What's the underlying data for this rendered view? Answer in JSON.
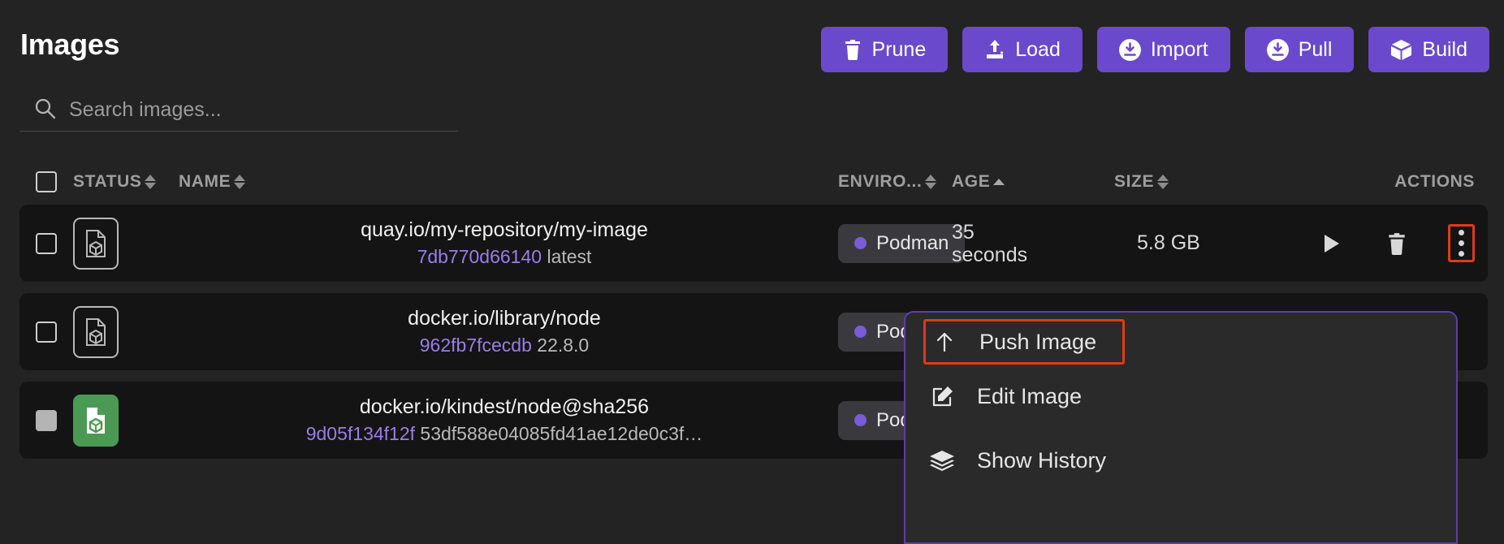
{
  "header": {
    "title": "Images",
    "buttons": [
      {
        "label": "Prune",
        "icon": "trash-icon"
      },
      {
        "label": "Load",
        "icon": "upload-icon"
      },
      {
        "label": "Import",
        "icon": "download-circle-icon"
      },
      {
        "label": "Pull",
        "icon": "download-circle-icon"
      },
      {
        "label": "Build",
        "icon": "cube-icon"
      }
    ],
    "accent_color": "#6a49cc"
  },
  "search": {
    "placeholder": "Search images...",
    "value": "",
    "icon": "search-icon"
  },
  "table": {
    "columns": [
      {
        "key": "check",
        "label": "",
        "sortable": false
      },
      {
        "key": "status",
        "label": "STATUS",
        "sortable": true,
        "sort": "none"
      },
      {
        "key": "name",
        "label": "NAME",
        "sortable": true,
        "sort": "none"
      },
      {
        "key": "env",
        "label": "ENVIRO...",
        "sortable": true,
        "sort": "none"
      },
      {
        "key": "age",
        "label": "AGE",
        "sortable": true,
        "sort": "asc"
      },
      {
        "key": "size",
        "label": "SIZE",
        "sortable": true,
        "sort": "none"
      },
      {
        "key": "actions",
        "label": "ACTIONS",
        "sortable": false
      }
    ],
    "rows": [
      {
        "checked": false,
        "status_icon": "image-file-icon",
        "status_color": "#b9b9b9",
        "name": "quay.io/my-repository/my-image",
        "image_id": "7db770d66140",
        "tag": "latest",
        "environment": "Podman",
        "age": "35 seconds",
        "size": "5.8 GB",
        "actions": [
          "run-icon",
          "delete-icon",
          "kebab-icon"
        ],
        "kebab_highlighted": true
      },
      {
        "checked": false,
        "status_icon": "image-file-icon",
        "status_color": "#b9b9b9",
        "name": "docker.io/library/node",
        "image_id": "962fb7fcecdb",
        "tag": "22.8.0",
        "environment": "Podman",
        "age": "",
        "size": "",
        "actions": [],
        "kebab_highlighted": false
      },
      {
        "checked": true,
        "status_icon": "image-file-icon",
        "status_color": "#4b9a54",
        "name": "docker.io/kindest/node@sha256",
        "image_id": "9d05f134f12f",
        "tag": "53df588e04085fd41ae12de0c3f…",
        "environment": "Podman",
        "age": "",
        "size": "",
        "actions": [],
        "kebab_highlighted": false
      }
    ]
  },
  "dropdown": {
    "items": [
      {
        "label": "Push Image",
        "icon": "arrow-up-icon",
        "highlighted": true
      },
      {
        "label": "Edit Image",
        "icon": "pencil-icon",
        "highlighted": false
      },
      {
        "label": "Show History",
        "icon": "layers-icon",
        "highlighted": false
      }
    ],
    "border_color": "#5b3fa8",
    "highlight_color": "#e03a18"
  }
}
